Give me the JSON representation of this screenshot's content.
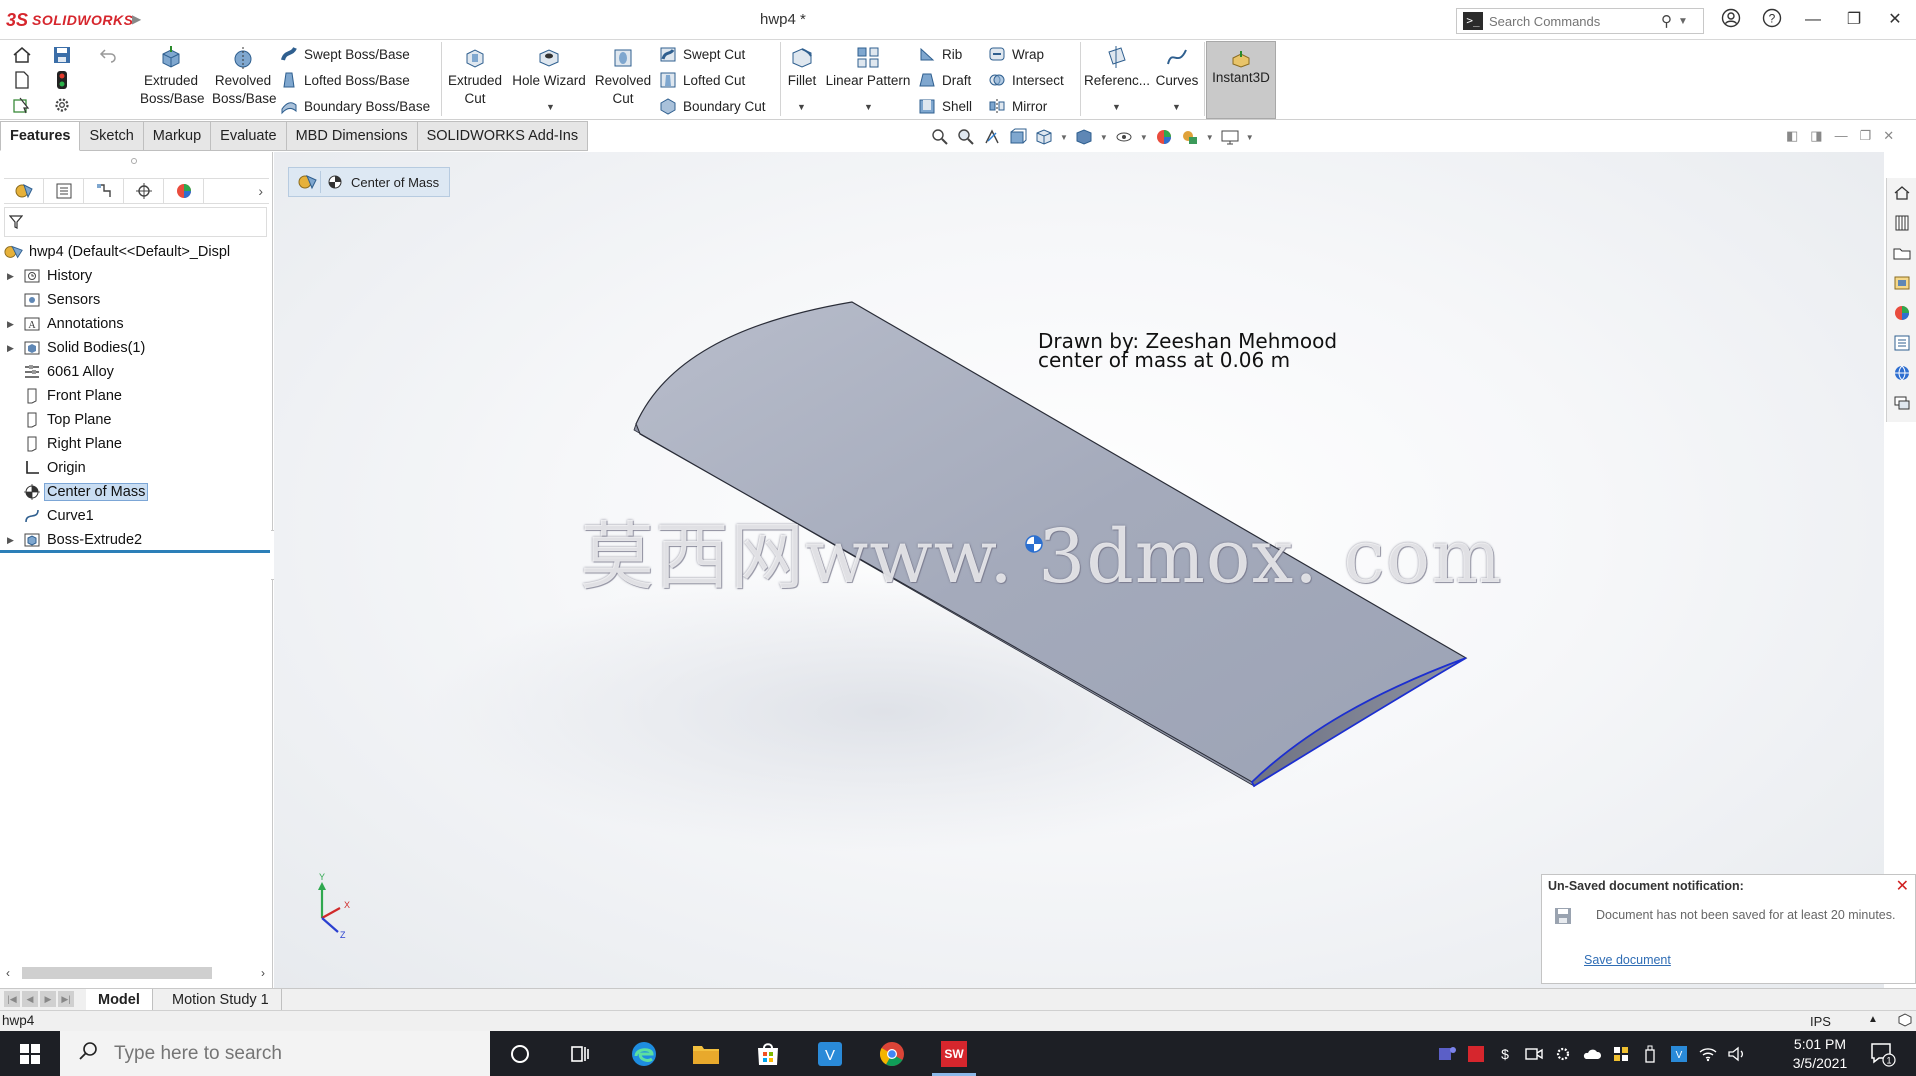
{
  "titlebar": {
    "logo_mark": "3S",
    "logo_text": "SOLIDWORKS",
    "document_title": "hwp4 *",
    "search_placeholder": "Search Commands"
  },
  "ribbon": {
    "extruded_boss": "Extruded Boss/Base",
    "revolved_boss": "Revolved Boss/Base",
    "swept_boss": "Swept Boss/Base",
    "lofted_boss": "Lofted Boss/Base",
    "boundary_boss": "Boundary Boss/Base",
    "extruded_cut": "Extruded Cut",
    "hole_wizard": "Hole Wizard",
    "revolved_cut": "Revolved Cut",
    "swept_cut": "Swept Cut",
    "lofted_cut": "Lofted Cut",
    "boundary_cut": "Boundary Cut",
    "fillet": "Fillet",
    "linear_pattern": "Linear Pattern",
    "rib": "Rib",
    "draft": "Draft",
    "shell": "Shell",
    "wrap": "Wrap",
    "intersect": "Intersect",
    "mirror": "Mirror",
    "reference": "Referenc...",
    "curves": "Curves",
    "instant3d": "Instant3D"
  },
  "tabs": [
    "Features",
    "Sketch",
    "Markup",
    "Evaluate",
    "MBD Dimensions",
    "SOLIDWORKS Add-Ins"
  ],
  "tree": {
    "root": "hwp4  (Default<<Default>_Displ",
    "items": [
      {
        "label": "History",
        "expandable": true,
        "icon": "history-icon"
      },
      {
        "label": "Sensors",
        "expandable": false,
        "icon": "sensors-icon"
      },
      {
        "label": "Annotations",
        "expandable": true,
        "icon": "annotations-icon"
      },
      {
        "label": "Solid Bodies(1)",
        "expandable": true,
        "icon": "solid-bodies-icon"
      },
      {
        "label": "6061 Alloy",
        "expandable": false,
        "icon": "material-icon"
      },
      {
        "label": "Front Plane",
        "expandable": false,
        "icon": "plane-icon"
      },
      {
        "label": "Top Plane",
        "expandable": false,
        "icon": "plane-icon"
      },
      {
        "label": "Right Plane",
        "expandable": false,
        "icon": "plane-icon"
      },
      {
        "label": "Origin",
        "expandable": false,
        "icon": "origin-icon"
      },
      {
        "label": "Center of Mass",
        "expandable": false,
        "icon": "center-of-mass-icon",
        "selected": true
      },
      {
        "label": "Curve1",
        "expandable": false,
        "icon": "curve-icon"
      },
      {
        "label": "Boss-Extrude2",
        "expandable": true,
        "icon": "boss-extrude-icon"
      }
    ]
  },
  "viewport": {
    "breadcrumb": "Center of Mass",
    "annotation_line1": "Drawn by: Zeeshan Mehmood",
    "annotation_line2": "center of mass at 0.06 m",
    "watermark": "莫西网www. 3dmox. com",
    "triad_y": "Y",
    "triad_x": "X",
    "triad_z": "Z"
  },
  "notification": {
    "title": "Un-Saved document notification:",
    "message": "Document has not been saved for at least 20 minutes.",
    "link": "Save document"
  },
  "bottom_tabs": [
    "Model",
    "Motion Study 1"
  ],
  "status": {
    "left": "hwp4",
    "units": "IPS"
  },
  "taskbar": {
    "search_placeholder": "Type here to search",
    "time": "5:01 PM",
    "date": "3/5/2021",
    "notification_count": "1"
  },
  "colors": {
    "accent": "#2c7fb8",
    "brand": "#d6262d",
    "model_face": "#a7adbe",
    "edge_highlight": "#1c2fd0"
  }
}
